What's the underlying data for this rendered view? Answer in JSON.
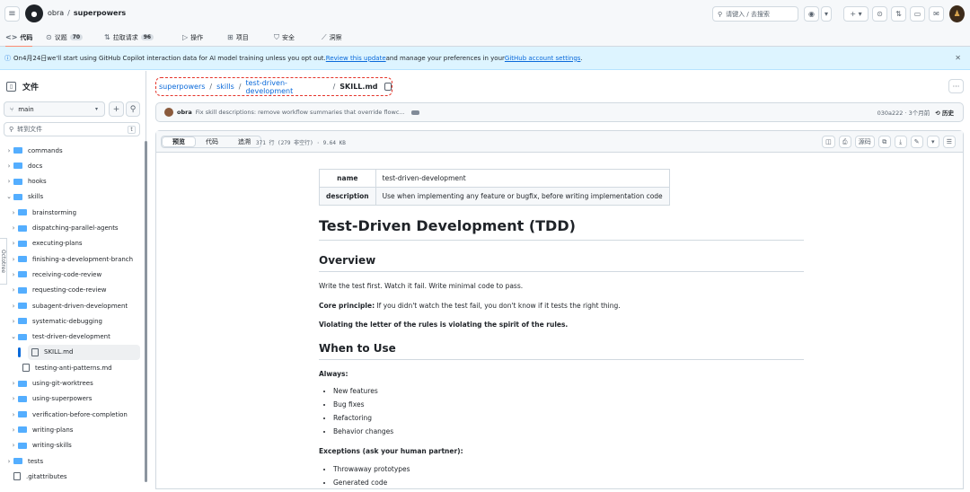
{
  "topbar": {
    "owner": "obra",
    "repo": "superpowers",
    "search_placeholder": "请键入 / 去搜索",
    "kbd_hint": "/"
  },
  "tabs": [
    {
      "label": "代码",
      "icon": "code-icon"
    },
    {
      "label": "议题",
      "count": "70",
      "icon": "issue-icon"
    },
    {
      "label": "拉取请求",
      "count": "96",
      "icon": "pull-request-icon"
    },
    {
      "label": "操作",
      "icon": "play-icon"
    },
    {
      "label": "项目",
      "icon": "table-icon"
    },
    {
      "label": "安全",
      "icon": "shield-icon"
    },
    {
      "label": "洞察",
      "icon": "graph-icon"
    }
  ],
  "banner": {
    "text_before": "On4月24日we'll start using GitHub Copilot interaction data for AI model training unless you opt out. ",
    "link1": "Review this update",
    "text_middle": " and manage your preferences in your ",
    "link2": "GitHub account settings",
    "text_after": "."
  },
  "sidebar": {
    "title": "文件",
    "branch": "main",
    "goto_placeholder": "转到文件",
    "goto_kbd": "t",
    "octotree_label": "Octotree",
    "items": [
      {
        "label": "commands",
        "type": "folder",
        "level": 0,
        "expanded": false
      },
      {
        "label": "docs",
        "type": "folder",
        "level": 0,
        "expanded": false
      },
      {
        "label": "hooks",
        "type": "folder",
        "level": 0,
        "expanded": false
      },
      {
        "label": "skills",
        "type": "folder",
        "level": 0,
        "expanded": true
      },
      {
        "label": "brainstorming",
        "type": "folder",
        "level": 1,
        "expanded": false
      },
      {
        "label": "dispatching-parallel-agents",
        "type": "folder",
        "level": 1,
        "expanded": false
      },
      {
        "label": "executing-plans",
        "type": "folder",
        "level": 1,
        "expanded": false
      },
      {
        "label": "finishing-a-development-branch",
        "type": "folder",
        "level": 1,
        "expanded": false
      },
      {
        "label": "receiving-code-review",
        "type": "folder",
        "level": 1,
        "expanded": false
      },
      {
        "label": "requesting-code-review",
        "type": "folder",
        "level": 1,
        "expanded": false
      },
      {
        "label": "subagent-driven-development",
        "type": "folder",
        "level": 1,
        "expanded": false
      },
      {
        "label": "systematic-debugging",
        "type": "folder",
        "level": 1,
        "expanded": false
      },
      {
        "label": "test-driven-development",
        "type": "folder",
        "level": 1,
        "expanded": true
      },
      {
        "label": "SKILL.md",
        "type": "file",
        "level": 2,
        "selected": true
      },
      {
        "label": "testing-anti-patterns.md",
        "type": "file",
        "level": 2
      },
      {
        "label": "using-git-worktrees",
        "type": "folder",
        "level": 1,
        "expanded": false
      },
      {
        "label": "using-superpowers",
        "type": "folder",
        "level": 1,
        "expanded": false
      },
      {
        "label": "verification-before-completion",
        "type": "folder",
        "level": 1,
        "expanded": false
      },
      {
        "label": "writing-plans",
        "type": "folder",
        "level": 1,
        "expanded": false
      },
      {
        "label": "writing-skills",
        "type": "folder",
        "level": 1,
        "expanded": false
      },
      {
        "label": "tests",
        "type": "folder",
        "level": 0,
        "expanded": false
      },
      {
        "label": ".gitattributes",
        "type": "file",
        "level": 0
      }
    ]
  },
  "path": {
    "parts": [
      "superpowers",
      "skills",
      "test-driven-development"
    ],
    "current": "SKILL.md"
  },
  "commit": {
    "author": "obra",
    "message": "Fix skill descriptions: remove workflow summaries that override flowc...",
    "sha": "030a222",
    "time": "3个月前",
    "history_label": "历史"
  },
  "viewer": {
    "tabs": [
      "预览",
      "代码",
      "追溯"
    ],
    "active_tab": "预览",
    "line_info": "371 行 (279 非空行) · 9.64 KB",
    "raw_label": "源码"
  },
  "doc": {
    "meta": [
      {
        "key": "name",
        "value": "test-driven-development"
      },
      {
        "key": "description",
        "value": "Use when implementing any feature or bugfix, before writing implementation code"
      }
    ],
    "title": "Test-Driven Development (TDD)",
    "overview_heading": "Overview",
    "overview_text": "Write the test first. Watch it fail. Write minimal code to pass.",
    "core_label": "Core principle:",
    "core_text": " If you didn't watch the test fail, you don't know if it tests the right thing.",
    "violating": "Violating the letter of the rules is violating the spirit of the rules.",
    "when_heading": "When to Use",
    "always_label": "Always:",
    "always_items": [
      "New features",
      "Bug fixes",
      "Refactoring",
      "Behavior changes"
    ],
    "exceptions_label": "Exceptions (ask your human partner):",
    "exception_items": [
      "Throwaway prototypes",
      "Generated code"
    ]
  }
}
